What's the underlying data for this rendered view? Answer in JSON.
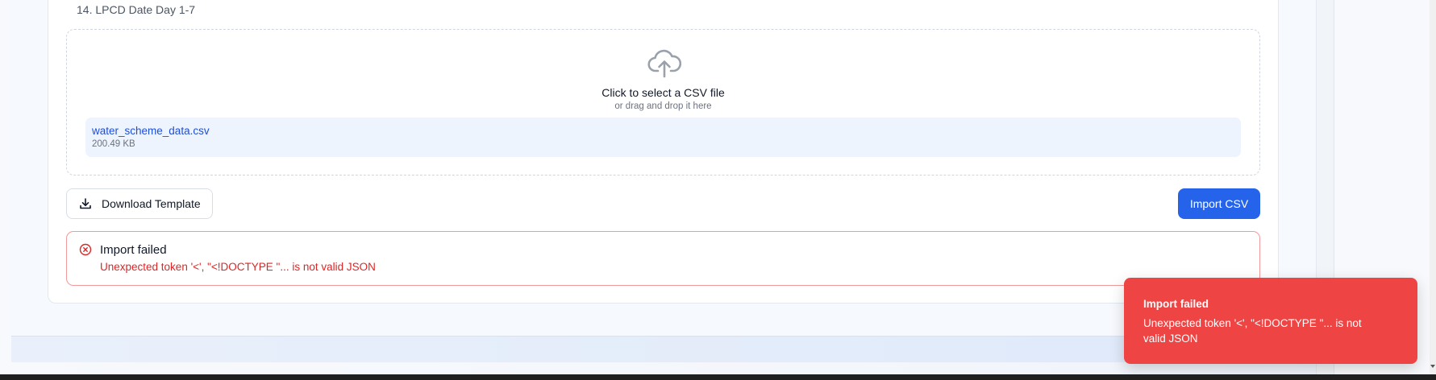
{
  "instructions": {
    "list_item": "14. LPCD Date Day 1-7"
  },
  "dropzone": {
    "title": "Click to select a CSV file",
    "subtitle": "or drag and drop it here",
    "icon": "cloud-upload-icon"
  },
  "selected_file": {
    "name": "water_scheme_data.csv",
    "size": "200.49 KB"
  },
  "actions": {
    "download_template_label": "Download Template",
    "download_icon": "download-icon",
    "import_label": "Import CSV"
  },
  "error": {
    "icon": "x-circle-icon",
    "title": "Import failed",
    "message": "Unexpected token '<', \"<!DOCTYPE \"... is not valid JSON"
  },
  "toast": {
    "title": "Import failed",
    "message": "Unexpected token '<', \"<!DOCTYPE \"... is not valid JSON"
  },
  "colors": {
    "primary": "#2563eb",
    "error": "#dc2626",
    "toast_bg": "#ef4444",
    "file_chip_bg": "#eef4fd"
  }
}
